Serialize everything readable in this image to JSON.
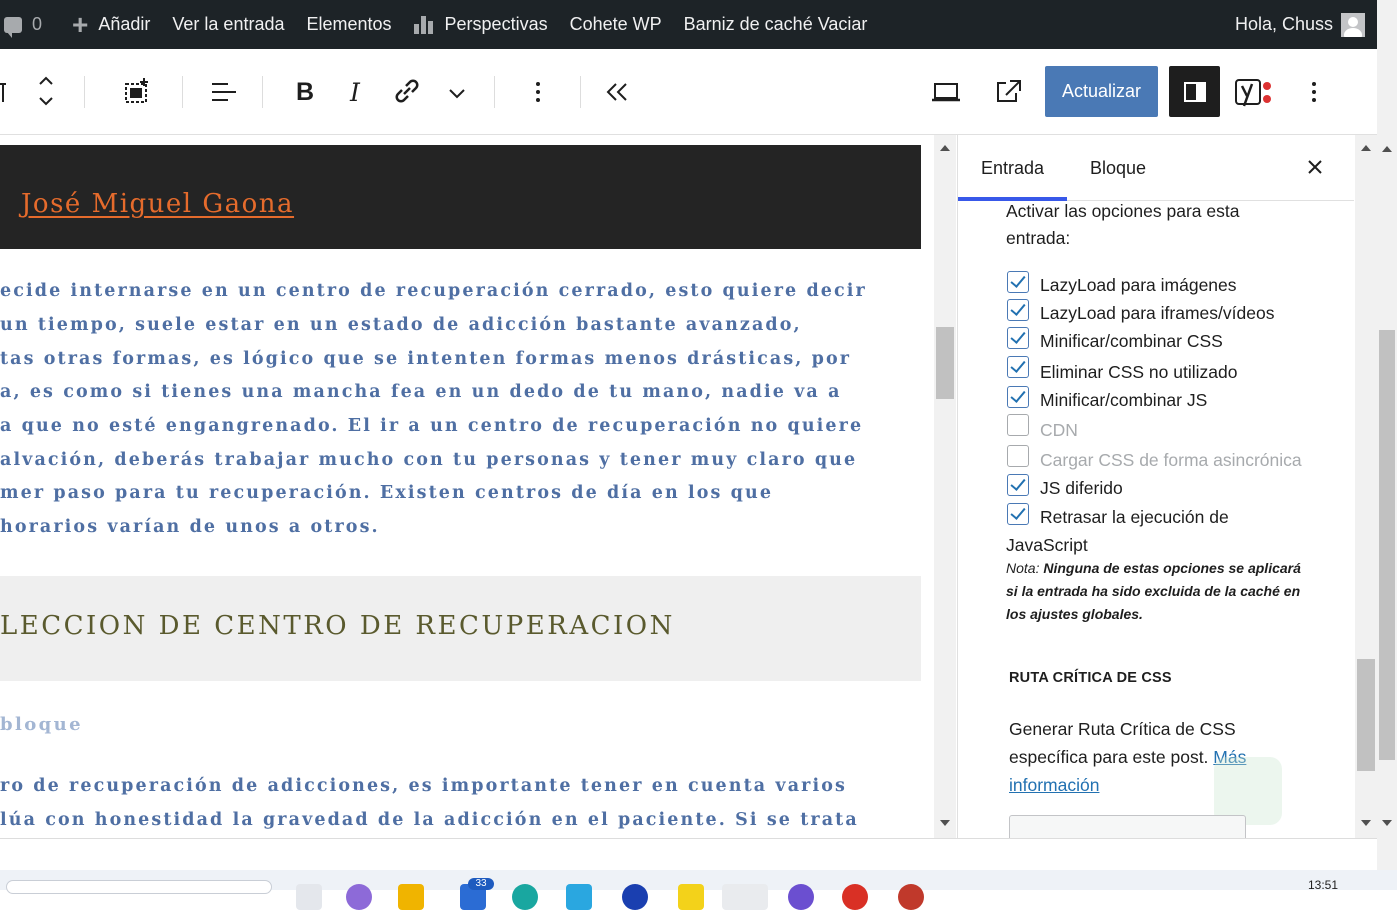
{
  "admin_bar": {
    "comments_count": "0",
    "add_new": "Añadir",
    "view_post": "Ver la entrada",
    "elements": "Elementos",
    "insights": "Perspectivas",
    "rocket": "Cohete WP",
    "varnish": "Barniz de caché Vaciar",
    "greeting": "Hola, Chuss"
  },
  "toolbar": {
    "update_label": "Actualizar",
    "bold": "B",
    "italic": "I"
  },
  "content": {
    "author_name": "José Miguel Gaona",
    "paragraph_lines": [
      "ecide internarse en un centro de recuperación cerrado, esto quiere decir",
      " un tiempo, suele estar en un estado de adicción bastante avanzado,",
      "tas otras formas, es lógico que se intenten formas menos drásticas, por",
      "a, es como si tienes una mancha fea en un dedo de tu mano, nadie va a",
      "a que no esté engangrenado. El ir a un centro de recuperación no quiere",
      "alvación, deberás trabajar mucho con tu personas y tener muy claro que",
      "mer paso para tu recuperación. Existen centros de día en los que",
      "horarios varían de unos a otros."
    ],
    "heading": "LECCION DE CENTRO DE RECUPERACION",
    "placeholder": " bloque",
    "paragraph2_lines": [
      "ro de recuperación de adicciones, es importante tener en cuenta varios",
      "lúa con honestidad la gravedad de la adicción en el paciente. Si se trata"
    ]
  },
  "sidebar": {
    "tab_post": "Entrada",
    "tab_block": "Bloque",
    "intro_line1": "Activar las opciones para esta",
    "intro_line2": "entrada:",
    "options": [
      {
        "label": "LazyLoad para imágenes",
        "checked": true,
        "disabled": false
      },
      {
        "label": "LazyLoad para iframes/vídeos",
        "checked": true,
        "disabled": false
      },
      {
        "label": "Minificar/combinar CSS",
        "checked": true,
        "disabled": false
      },
      {
        "label": "Eliminar CSS no utilizado",
        "checked": true,
        "disabled": false
      },
      {
        "label": "Minificar/combinar JS",
        "checked": true,
        "disabled": false
      },
      {
        "label": "CDN",
        "checked": false,
        "disabled": true
      },
      {
        "label": "Cargar CSS de forma asincrónica",
        "checked": false,
        "disabled": true
      },
      {
        "label": "JS diferido",
        "checked": true,
        "disabled": false
      },
      {
        "label": "Retrasar la ejecución de",
        "checked": true,
        "disabled": false
      }
    ],
    "option_wrap": "JavaScript",
    "note_label": "Nota:",
    "note_text": "Ninguna de estas opciones se aplicará si la entrada ha sido excluida de la caché en los ajustes globales.",
    "critical_title": "RUTA CRÍTICA DE CSS",
    "critical_text": "Generar Ruta Crítica de CSS específica para este post.",
    "critical_link": "Más información"
  },
  "taskbar": {
    "clock": "13:51",
    "badge": "33"
  }
}
